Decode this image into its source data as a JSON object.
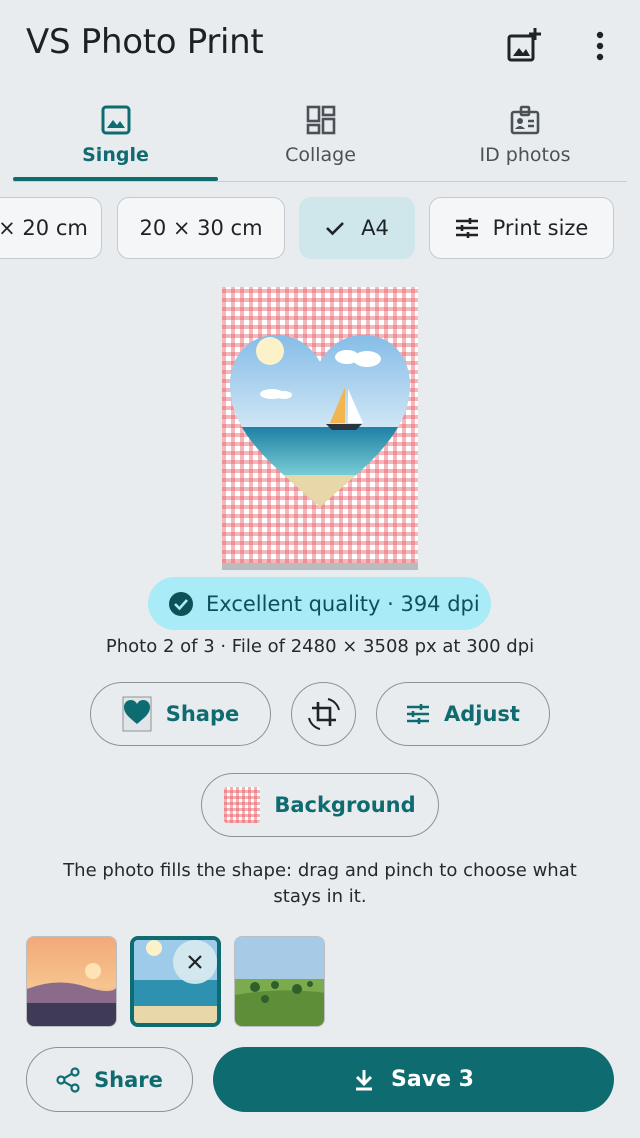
{
  "app": {
    "title": "VS Photo Print"
  },
  "tabs": [
    {
      "label": "Single",
      "icon": "image-icon",
      "active": true
    },
    {
      "label": "Collage",
      "icon": "collage-grid-icon",
      "active": false
    },
    {
      "label": "ID photos",
      "icon": "id-badge-icon",
      "active": false
    }
  ],
  "sizes": [
    {
      "label": "× 20 cm"
    },
    {
      "label": "20 × 30 cm"
    },
    {
      "label": "A4",
      "selected": true
    },
    {
      "label": "Print size",
      "icon": "tune-icon"
    }
  ],
  "quality": {
    "text": "Excellent quality · 394 dpi"
  },
  "photo_info": "Photo 2 of 3 · File of 2480 × 3508 px at 300 dpi",
  "actions": {
    "shape": "Shape",
    "adjust": "Adjust",
    "background": "Background"
  },
  "hint": "The photo fills the shape: drag and pinch to choose what stays in it.",
  "thumbnails": [
    {
      "name": "sunset-photo"
    },
    {
      "name": "beach-sailboat-photo",
      "selected": true
    },
    {
      "name": "green-field-photo"
    }
  ],
  "bottom": {
    "share": "Share",
    "save": "Save 3"
  },
  "colors": {
    "accent": "#0e6b70",
    "quality_bg": "#a9ebf6",
    "selected_chip": "#cfe6ea",
    "background": "#e9ecef"
  }
}
